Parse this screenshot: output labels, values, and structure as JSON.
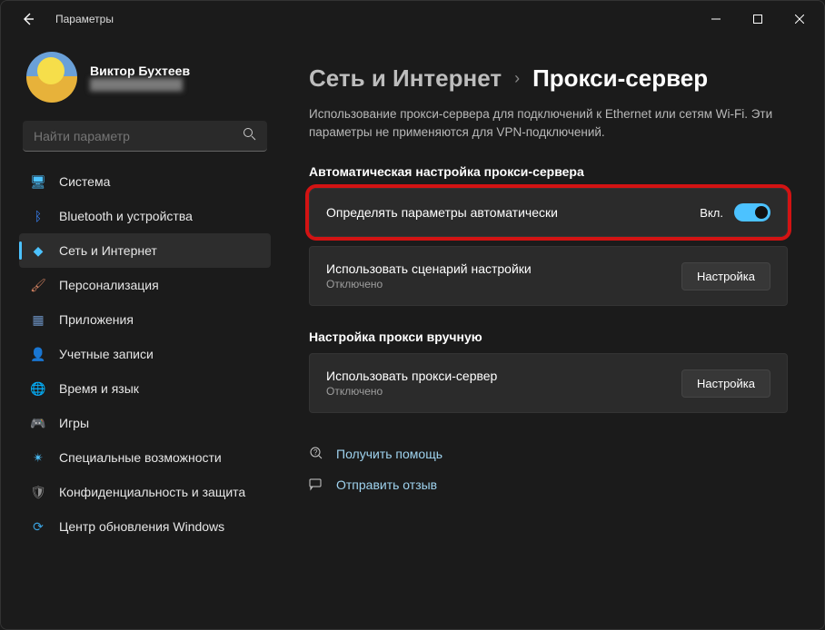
{
  "window": {
    "title": "Параметры"
  },
  "profile": {
    "name": "Виктор Бухтеев",
    "email": "████████████"
  },
  "search": {
    "placeholder": "Найти параметр"
  },
  "nav": [
    {
      "icon": "system-icon",
      "label": "Система",
      "color": "#4cc2ff"
    },
    {
      "icon": "bluetooth-icon",
      "label": "Bluetooth и устройства",
      "color": "#3a86ff"
    },
    {
      "icon": "wifi-icon",
      "label": "Сеть и Интернет",
      "color": "#4cc2ff",
      "active": true
    },
    {
      "icon": "brush-icon",
      "label": "Персонализация",
      "color": "#d08060"
    },
    {
      "icon": "apps-icon",
      "label": "Приложения",
      "color": "#6a8fbf"
    },
    {
      "icon": "account-icon",
      "label": "Учетные записи",
      "color": "#6fbf6f"
    },
    {
      "icon": "time-icon",
      "label": "Время и язык",
      "color": "#4cc2ff"
    },
    {
      "icon": "games-icon",
      "label": "Игры",
      "color": "#6f8fbf"
    },
    {
      "icon": "a11y-icon",
      "label": "Специальные возможности",
      "color": "#4cc2ff"
    },
    {
      "icon": "privacy-icon",
      "label": "Конфиденциальность и защита",
      "color": "#8f8f8f"
    },
    {
      "icon": "update-icon",
      "label": "Центр обновления Windows",
      "color": "#3aa0dd"
    }
  ],
  "breadcrumb": {
    "parent": "Сеть и Интернет",
    "current": "Прокси-сервер"
  },
  "description": "Использование прокси-сервера для подключений к Ethernet или сетям Wi-Fi. Эти параметры не применяются для VPN-подключений.",
  "sections": {
    "auto": {
      "title": "Автоматическая настройка прокси-сервера",
      "row1": {
        "title": "Определять параметры автоматически",
        "state": "Вкл."
      },
      "row2": {
        "title": "Использовать сценарий настройки",
        "sub": "Отключено",
        "btn": "Настройка"
      }
    },
    "manual": {
      "title": "Настройка прокси вручную",
      "row1": {
        "title": "Использовать прокси-сервер",
        "sub": "Отключено",
        "btn": "Настройка"
      }
    }
  },
  "links": {
    "help": "Получить помощь",
    "feedback": "Отправить отзыв"
  }
}
